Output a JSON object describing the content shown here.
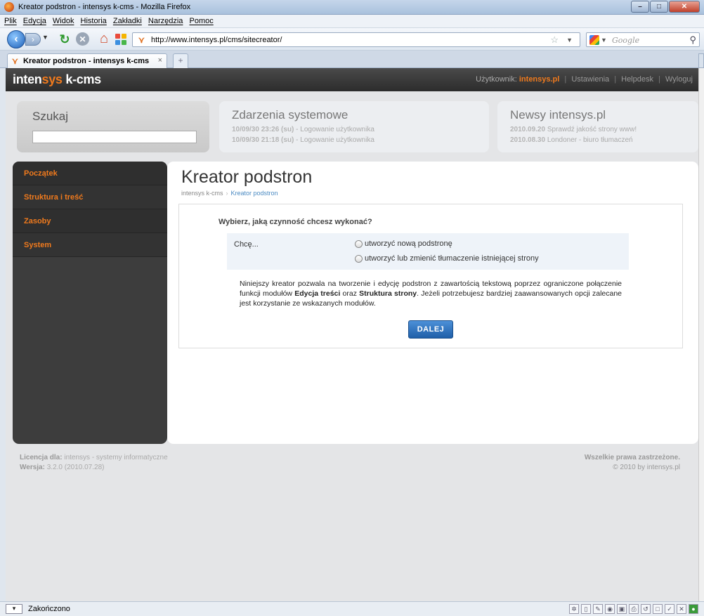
{
  "window": {
    "title": "Kreator podstron - intensys k-cms - Mozilla Firefox"
  },
  "menu": [
    "Plik",
    "Edycja",
    "Widok",
    "Historia",
    "Zakładki",
    "Narzędzia",
    "Pomoc"
  ],
  "nav": {
    "url": "http://www.intensys.pl/cms/sitecreator/",
    "search_placeholder": "Google"
  },
  "tab": {
    "label": "Kreator podstron - intensys k-cms"
  },
  "cms": {
    "logo_a": "inten",
    "logo_b": "sys",
    "logo_c": " k-cms",
    "user_label": "Użytkownik:",
    "user_name": "intensys.pl",
    "links": [
      "Ustawienia",
      "Helpdesk",
      "Wyloguj"
    ]
  },
  "search_box": {
    "title": "Szukaj"
  },
  "events": {
    "title": "Zdarzenia systemowe",
    "items": [
      {
        "time": "10/09/30 23:26 (su)",
        "text": "- Logowanie użytkownika"
      },
      {
        "time": "10/09/30 21:18 (su)",
        "text": "- Logowanie użytkownika"
      }
    ]
  },
  "news": {
    "title": "Newsy intensys.pl",
    "items": [
      {
        "date": "2010.09.20",
        "text": "Sprawdź jakość strony www!"
      },
      {
        "date": "2010.08.30",
        "text": "Londoner - biuro tłumaczeń"
      }
    ]
  },
  "sidebar": [
    "Początek",
    "Struktura i treść",
    "Zasoby",
    "System"
  ],
  "main": {
    "title": "Kreator podstron",
    "crumb_root": "intensys k-cms",
    "crumb_sep": "›",
    "crumb_current": "Kreator podstron",
    "question": "Wybierz, jaką czynność chcesz wykonać?",
    "want_label": "Chcę...",
    "options": [
      "utworzyć nową podstronę",
      "utworzyć lub zmienić tłumaczenie istniejącej strony"
    ],
    "desc_1": "Niniejszy kreator pozwala na tworzenie i edycję podstron z zawartością tekstową poprzez ograniczone połączenie funkcji modułów ",
    "desc_b1": "Edycja treści",
    "desc_2": " oraz ",
    "desc_b2": "Struktura strony",
    "desc_3": ". Jeżeli potrzebujesz bardziej zaawansowanych opcji zalecane jest korzystanie ze wskazanych modułów.",
    "next_button": "DALEJ"
  },
  "footer": {
    "license_label": "Licencja dla:",
    "license_value": "intensys - systemy informatyczne",
    "version_label": "Wersja:",
    "version_value": "3.2.0 (2010.07.28)",
    "rights": "Wszelkie prawa zastrzeżone.",
    "copyright": "© 2010 by intensys.pl"
  },
  "status": {
    "text": "Zakończono"
  },
  "colors": {
    "accent": "#f07a1d",
    "link": "#4a8ac2",
    "button": "#2a6fbd"
  }
}
